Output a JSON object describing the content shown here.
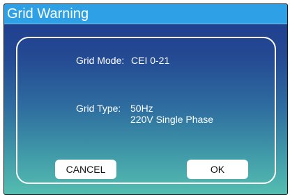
{
  "window": {
    "title": "Grid Warning"
  },
  "dialog": {
    "grid_mode_label": "Grid Mode:",
    "grid_mode_value": "CEI 0-21",
    "grid_type_label": "Grid Type:",
    "grid_type_line1": "50Hz",
    "grid_type_line2": "220V Single Phase"
  },
  "buttons": {
    "cancel_label": "CANCEL",
    "ok_label": "OK"
  },
  "colors": {
    "title_bar": "#2ea1e6",
    "gradient_top": "#1d3a8c",
    "gradient_bottom": "#55bdb0",
    "text": "#ffffff"
  }
}
